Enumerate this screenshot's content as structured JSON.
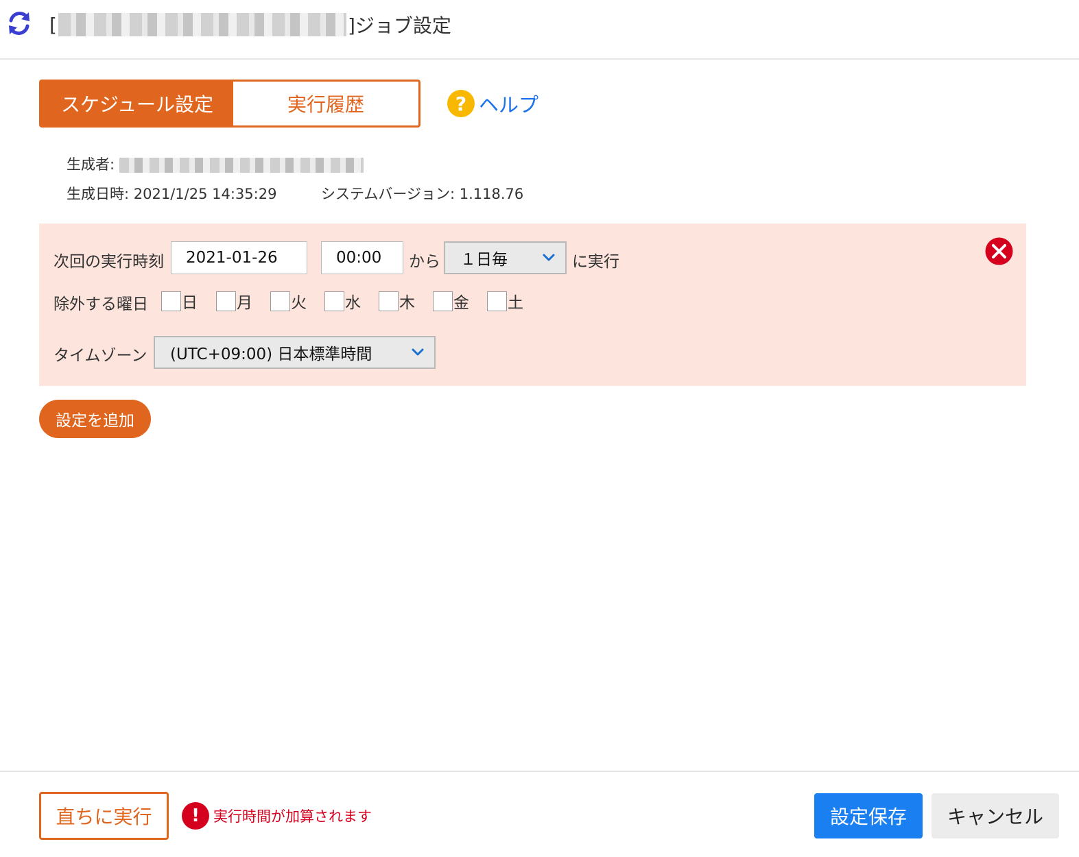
{
  "header": {
    "title_prefix": "[",
    "title_suffix": "]ジョブ設定",
    "icon": "refresh-icon"
  },
  "tabs": [
    {
      "label": "スケジュール設定",
      "active": true
    },
    {
      "label": "実行履歴",
      "active": false
    }
  ],
  "help": {
    "label": "ヘルプ",
    "icon": "help-icon"
  },
  "meta": {
    "creator_label": "生成者:",
    "created_at_label": "生成日時:",
    "created_at": "2021/1/25 14:35:29",
    "system_version_label": "システムバージョン:",
    "system_version": "1.118.76"
  },
  "schedule": {
    "next_run_label": "次回の実行時刻",
    "date": "2021-01-26",
    "time": "00:00",
    "from_label": "から",
    "interval": "１日毎",
    "run_label": "に実行",
    "exclude_label": "除外する曜日",
    "days": [
      "日",
      "月",
      "火",
      "水",
      "木",
      "金",
      "土"
    ],
    "timezone_label": "タイムゾーン",
    "timezone": "(UTC+09:00) 日本標準時間"
  },
  "actions": {
    "add_setting": "設定を追加",
    "run_now": "直ちに実行",
    "warning": "実行時間が加算されます",
    "save": "設定保存",
    "cancel": "キャンセル"
  },
  "colors": {
    "accent": "#e0661f",
    "panel_bg": "#fde4dd",
    "primary": "#1a7ff0",
    "danger": "#d4001e",
    "help": "#f8b800"
  }
}
